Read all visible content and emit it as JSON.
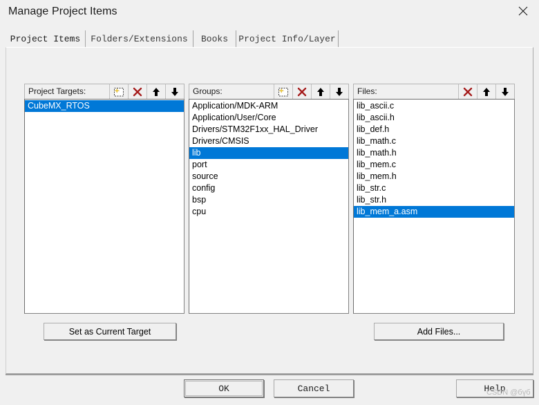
{
  "window": {
    "title": "Manage Project Items",
    "close_icon": "close-icon"
  },
  "tabs": [
    {
      "label": "Project Items",
      "active": true
    },
    {
      "label": "Folders/Extensions",
      "active": false
    },
    {
      "label": "Books",
      "active": false
    },
    {
      "label": "Project Info/Layer",
      "active": false
    }
  ],
  "columns": {
    "targets": {
      "label": "Project Targets:",
      "tools": [
        {
          "name": "new-item-icon",
          "title": "New (Insert)"
        },
        {
          "name": "delete-x-icon",
          "title": "Remove Item"
        },
        {
          "name": "arrow-up-icon",
          "title": "Move Up"
        },
        {
          "name": "arrow-down-icon",
          "title": "Move Down"
        }
      ],
      "items": [
        {
          "label": "CubeMX_RTOS",
          "selected": true
        }
      ]
    },
    "groups": {
      "label": "Groups:",
      "tools": [
        {
          "name": "new-item-icon",
          "title": "New (Insert)"
        },
        {
          "name": "delete-x-icon",
          "title": "Remove Item"
        },
        {
          "name": "arrow-up-icon",
          "title": "Move Up"
        },
        {
          "name": "arrow-down-icon",
          "title": "Move Down"
        }
      ],
      "items": [
        {
          "label": "Application/MDK-ARM",
          "selected": false
        },
        {
          "label": "Application/User/Core",
          "selected": false
        },
        {
          "label": "Drivers/STM32F1xx_HAL_Driver",
          "selected": false
        },
        {
          "label": "Drivers/CMSIS",
          "selected": false
        },
        {
          "label": "lib",
          "selected": true
        },
        {
          "label": "port",
          "selected": false
        },
        {
          "label": "source",
          "selected": false
        },
        {
          "label": "config",
          "selected": false
        },
        {
          "label": "bsp",
          "selected": false
        },
        {
          "label": "cpu",
          "selected": false
        }
      ]
    },
    "files": {
      "label": "Files:",
      "tools": [
        {
          "name": "delete-x-icon",
          "title": "Remove Item"
        },
        {
          "name": "arrow-up-icon",
          "title": "Move Up"
        },
        {
          "name": "arrow-down-icon",
          "title": "Move Down"
        }
      ],
      "items": [
        {
          "label": "lib_ascii.c",
          "selected": false
        },
        {
          "label": "lib_ascii.h",
          "selected": false
        },
        {
          "label": "lib_def.h",
          "selected": false
        },
        {
          "label": "lib_math.c",
          "selected": false
        },
        {
          "label": "lib_math.h",
          "selected": false
        },
        {
          "label": "lib_mem.c",
          "selected": false
        },
        {
          "label": "lib_mem.h",
          "selected": false
        },
        {
          "label": "lib_str.c",
          "selected": false
        },
        {
          "label": "lib_str.h",
          "selected": false
        },
        {
          "label": "lib_mem_a.asm",
          "selected": true
        }
      ]
    }
  },
  "buttons": {
    "set_current_target": "Set as Current Target",
    "add_files": "Add Files...",
    "ok": "OK",
    "cancel": "Cancel",
    "help": "Help"
  },
  "watermark": "CSDN @бүб",
  "colors": {
    "selection": "#0078d7",
    "selection_text": "#ffffff",
    "delete_x": "#a51b1b",
    "dialog_bg": "#f0f0f0",
    "list_bg": "#ffffff"
  }
}
